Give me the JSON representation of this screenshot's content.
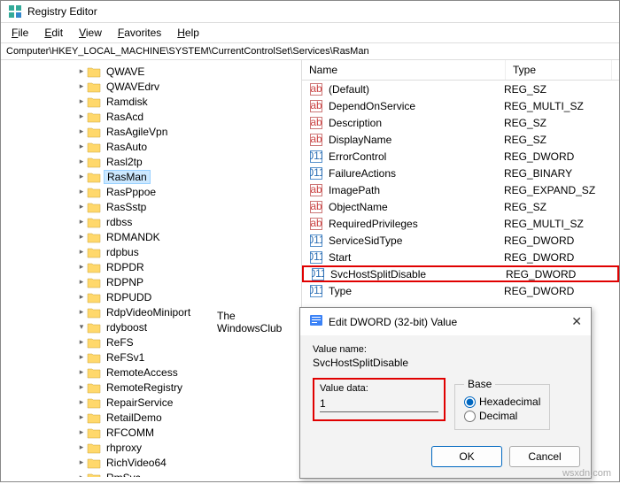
{
  "window": {
    "title": "Registry Editor"
  },
  "menu": {
    "file": "File",
    "edit": "Edit",
    "view": "View",
    "favorites": "Favorites",
    "help": "Help"
  },
  "address": "Computer\\HKEY_LOCAL_MACHINE\\SYSTEM\\CurrentControlSet\\Services\\RasMan",
  "tree": [
    {
      "label": "QWAVE",
      "open": false,
      "sel": false
    },
    {
      "label": "QWAVEdrv",
      "open": false,
      "sel": false
    },
    {
      "label": "Ramdisk",
      "open": false,
      "sel": false
    },
    {
      "label": "RasAcd",
      "open": false,
      "sel": false
    },
    {
      "label": "RasAgileVpn",
      "open": false,
      "sel": false
    },
    {
      "label": "RasAuto",
      "open": false,
      "sel": false
    },
    {
      "label": "Rasl2tp",
      "open": false,
      "sel": false
    },
    {
      "label": "RasMan",
      "open": false,
      "sel": true
    },
    {
      "label": "RasPppoe",
      "open": false,
      "sel": false
    },
    {
      "label": "RasSstp",
      "open": false,
      "sel": false
    },
    {
      "label": "rdbss",
      "open": false,
      "sel": false
    },
    {
      "label": "RDMANDK",
      "open": false,
      "sel": false
    },
    {
      "label": "rdpbus",
      "open": false,
      "sel": false
    },
    {
      "label": "RDPDR",
      "open": false,
      "sel": false
    },
    {
      "label": "RDPNP",
      "open": false,
      "sel": false
    },
    {
      "label": "RDPUDD",
      "open": false,
      "sel": false
    },
    {
      "label": "RdpVideoMiniport",
      "open": false,
      "sel": false
    },
    {
      "label": "rdyboost",
      "open": true,
      "sel": false
    },
    {
      "label": "ReFS",
      "open": false,
      "sel": false
    },
    {
      "label": "ReFSv1",
      "open": false,
      "sel": false
    },
    {
      "label": "RemoteAccess",
      "open": false,
      "sel": false
    },
    {
      "label": "RemoteRegistry",
      "open": false,
      "sel": false
    },
    {
      "label": "RepairService",
      "open": false,
      "sel": false
    },
    {
      "label": "RetailDemo",
      "open": false,
      "sel": false
    },
    {
      "label": "RFCOMM",
      "open": false,
      "sel": false
    },
    {
      "label": "rhproxy",
      "open": false,
      "sel": false
    },
    {
      "label": "RichVideo64",
      "open": false,
      "sel": false
    },
    {
      "label": "RmSvc",
      "open": false,
      "sel": false
    }
  ],
  "headers": {
    "name": "Name",
    "type": "Type"
  },
  "values": [
    {
      "name": "(Default)",
      "type": "REG_SZ",
      "icon": "sz",
      "hl": false
    },
    {
      "name": "DependOnService",
      "type": "REG_MULTI_SZ",
      "icon": "sz",
      "hl": false
    },
    {
      "name": "Description",
      "type": "REG_SZ",
      "icon": "sz",
      "hl": false
    },
    {
      "name": "DisplayName",
      "type": "REG_SZ",
      "icon": "sz",
      "hl": false
    },
    {
      "name": "ErrorControl",
      "type": "REG_DWORD",
      "icon": "bin",
      "hl": false
    },
    {
      "name": "FailureActions",
      "type": "REG_BINARY",
      "icon": "bin",
      "hl": false
    },
    {
      "name": "ImagePath",
      "type": "REG_EXPAND_SZ",
      "icon": "sz",
      "hl": false
    },
    {
      "name": "ObjectName",
      "type": "REG_SZ",
      "icon": "sz",
      "hl": false
    },
    {
      "name": "RequiredPrivileges",
      "type": "REG_MULTI_SZ",
      "icon": "sz",
      "hl": false
    },
    {
      "name": "ServiceSidType",
      "type": "REG_DWORD",
      "icon": "bin",
      "hl": false
    },
    {
      "name": "Start",
      "type": "REG_DWORD",
      "icon": "bin",
      "hl": false
    },
    {
      "name": "SvcHostSplitDisable",
      "type": "REG_DWORD",
      "icon": "bin",
      "hl": true
    },
    {
      "name": "Type",
      "type": "REG_DWORD",
      "icon": "bin",
      "hl": false
    }
  ],
  "dialog": {
    "title": "Edit DWORD (32-bit) Value",
    "value_name_label": "Value name:",
    "value_name": "SvcHostSplitDisable",
    "value_data_label": "Value data:",
    "value_data": "1",
    "base_label": "Base",
    "hex_label": "Hexadecimal",
    "dec_label": "Decimal",
    "ok": "OK",
    "cancel": "Cancel"
  },
  "watermark": {
    "line1": "The",
    "line2": "WindowsClub",
    "src": "wsxdn.com"
  }
}
